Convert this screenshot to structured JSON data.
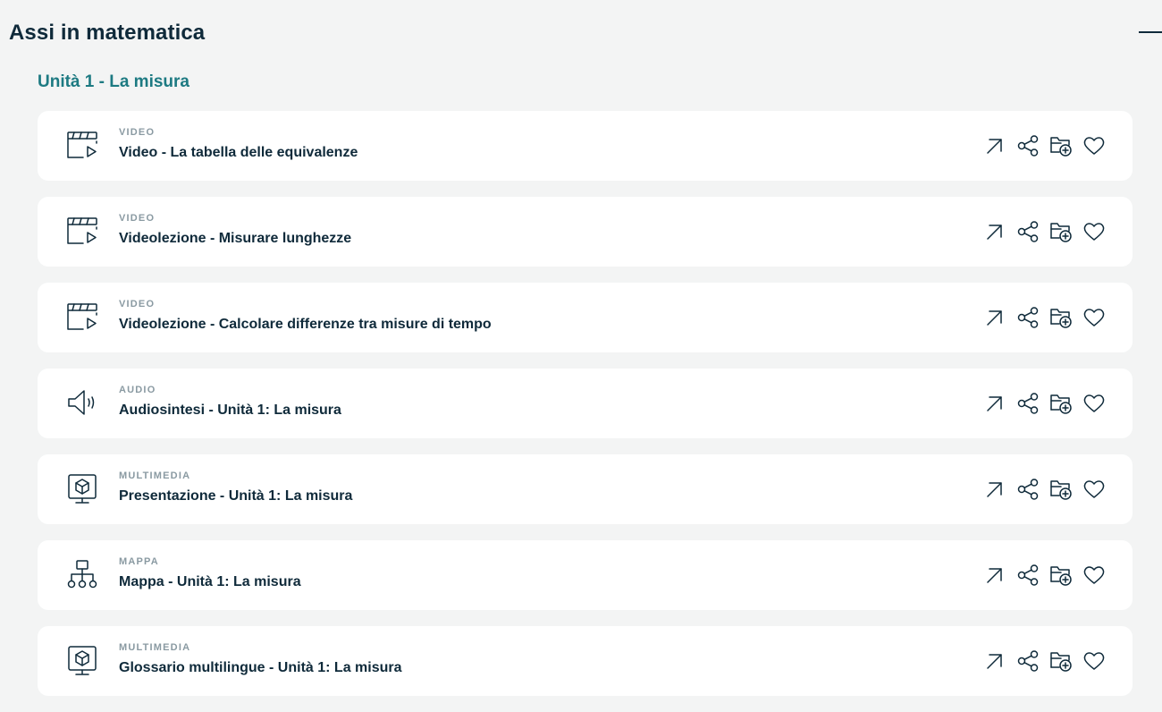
{
  "section": {
    "title": "Assi in matematica"
  },
  "unit": {
    "title": "Unità 1 - La misura"
  },
  "resources": [
    {
      "type": "VIDEO",
      "title": "Video - La tabella delle equivalenze",
      "icon": "video-icon"
    },
    {
      "type": "VIDEO",
      "title": "Videolezione - Misurare lunghezze",
      "icon": "video-icon"
    },
    {
      "type": "VIDEO",
      "title": "Videolezione - Calcolare differenze tra misure di tempo",
      "icon": "video-icon"
    },
    {
      "type": "AUDIO",
      "title": "Audiosintesi - Unità 1: La misura",
      "icon": "speaker-icon"
    },
    {
      "type": "MULTIMEDIA",
      "title": "Presentazione - Unità 1: La misura",
      "icon": "presentation-icon"
    },
    {
      "type": "MAPPA",
      "title": "Mappa - Unità 1: La misura",
      "icon": "concept-map-icon"
    },
    {
      "type": "MULTIMEDIA",
      "title": "Glossario multilingue - Unità 1: La misura",
      "icon": "presentation-icon"
    }
  ],
  "actions": [
    "open-external-icon",
    "share-icon",
    "add-to-folder-icon",
    "favorite-heart-icon"
  ],
  "colors": {
    "background": "#f3f4f4",
    "card": "#ffffff",
    "text": "#0f2a3a",
    "accent": "#1d7a82",
    "muted": "#8a9aa2"
  }
}
